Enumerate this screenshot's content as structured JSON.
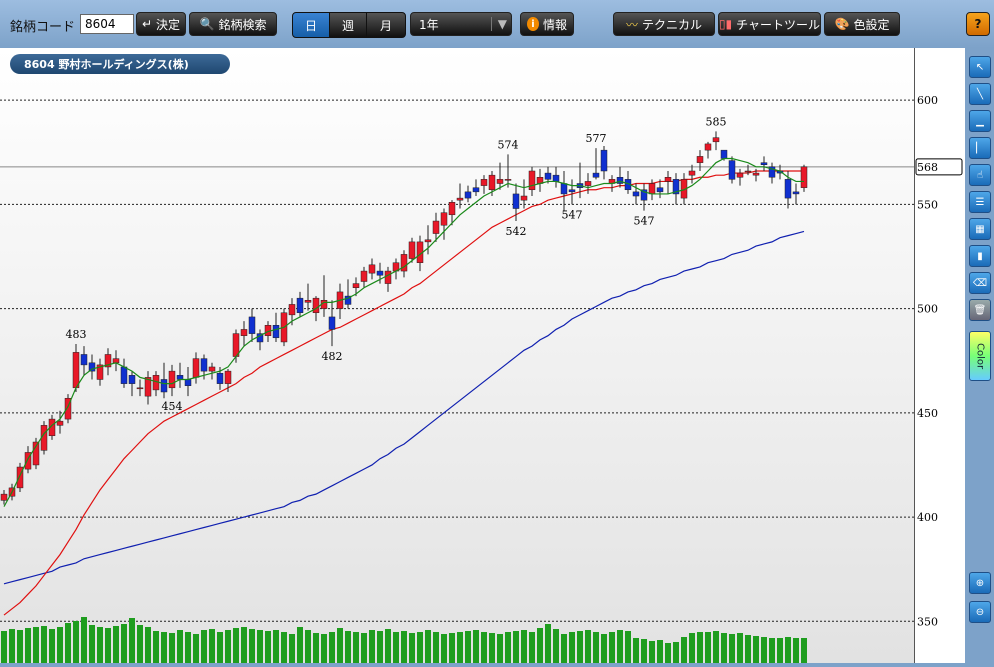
{
  "toolbar": {
    "code_label": "銘柄コード",
    "code_value": "8604",
    "decide_label": "決定",
    "search_label": "銘柄検索",
    "period_tabs": [
      "日",
      "週",
      "月"
    ],
    "range_value": "1年",
    "info_label": "情報",
    "technical_label": "テクニカル",
    "charttool_label": "チャートツール",
    "color_label": "色設定",
    "help_label": "?"
  },
  "chart": {
    "symbol": "8604 野村ホールディングス(株)",
    "current_price": "568",
    "price_labels": [
      "600",
      "550",
      "500",
      "450",
      "400",
      "350"
    ],
    "annotations": [
      "483",
      "454",
      "482",
      "574",
      "542",
      "577",
      "547",
      "547",
      "585"
    ]
  },
  "rightbar": {
    "color_label": "Color",
    "tools": [
      "pointer-icon",
      "trendline-icon",
      "horizontal-line-icon",
      "vertical-line-icon",
      "hand-icon",
      "fibonacci-icon",
      "count-icon",
      "span-icon",
      "eraser-icon",
      "trash-icon"
    ]
  },
  "chart_data": {
    "type": "candlestick",
    "ylim": [
      330,
      625
    ],
    "y_ticks": [
      600,
      550,
      500,
      450,
      400,
      350
    ],
    "current_price": 568,
    "candles": [
      [
        408,
        413,
        406,
        411
      ],
      [
        410,
        416,
        408,
        414
      ],
      [
        414,
        426,
        412,
        424
      ],
      [
        423,
        434,
        421,
        431
      ],
      [
        425,
        438,
        423,
        436
      ],
      [
        432,
        446,
        430,
        444
      ],
      [
        439,
        449,
        437,
        447
      ],
      [
        444,
        451,
        440,
        446
      ],
      [
        447,
        459,
        445,
        457
      ],
      [
        462,
        483,
        460,
        479
      ],
      [
        478,
        482,
        468,
        473
      ],
      [
        474,
        478,
        466,
        470
      ],
      [
        466,
        476,
        463,
        473
      ],
      [
        472,
        481,
        468,
        478
      ],
      [
        474,
        480,
        470,
        476
      ],
      [
        472,
        476,
        462,
        464
      ],
      [
        468,
        470,
        458,
        464
      ],
      [
        462,
        466,
        458,
        462
      ],
      [
        458,
        470,
        454,
        467
      ],
      [
        461,
        470,
        458,
        468
      ],
      [
        466,
        474,
        457,
        460
      ],
      [
        462,
        473,
        458,
        470
      ],
      [
        468,
        474,
        462,
        466
      ],
      [
        466,
        472,
        458,
        463
      ],
      [
        467,
        479,
        464,
        476
      ],
      [
        476,
        478,
        466,
        470
      ],
      [
        470,
        474,
        466,
        472
      ],
      [
        469,
        472,
        461,
        464
      ],
      [
        464,
        471,
        460,
        470
      ],
      [
        477,
        490,
        474,
        488
      ],
      [
        487,
        494,
        482,
        490
      ],
      [
        496,
        500,
        484,
        488
      ],
      [
        488,
        490,
        480,
        484
      ],
      [
        487,
        494,
        484,
        492
      ],
      [
        492,
        498,
        484,
        486
      ],
      [
        484,
        500,
        482,
        498
      ],
      [
        497,
        505,
        492,
        502
      ],
      [
        505,
        508,
        496,
        498
      ],
      [
        503,
        512,
        499,
        504
      ],
      [
        498,
        506,
        494,
        505
      ],
      [
        500,
        516,
        496,
        504
      ],
      [
        496,
        504,
        482,
        490
      ],
      [
        500,
        512,
        495,
        508
      ],
      [
        506,
        514,
        500,
        502
      ],
      [
        510,
        515,
        506,
        512
      ],
      [
        513,
        520,
        510,
        518
      ],
      [
        517,
        524,
        514,
        521
      ],
      [
        518,
        522,
        512,
        516
      ],
      [
        512,
        520,
        508,
        518
      ],
      [
        518,
        524,
        514,
        522
      ],
      [
        518,
        528,
        515,
        526
      ],
      [
        524,
        534,
        522,
        532
      ],
      [
        522,
        535,
        518,
        532
      ],
      [
        532,
        540,
        526,
        533
      ],
      [
        536,
        546,
        532,
        542
      ],
      [
        540,
        548,
        533,
        546
      ],
      [
        545,
        552,
        540,
        551
      ],
      [
        552,
        560,
        548,
        553
      ],
      [
        556,
        559,
        551,
        553
      ],
      [
        558,
        562,
        554,
        556
      ],
      [
        559,
        564,
        555,
        562
      ],
      [
        557,
        566,
        554,
        564
      ],
      [
        560,
        570,
        557,
        562
      ],
      [
        562,
        574,
        558,
        562
      ],
      [
        555,
        560,
        542,
        548
      ],
      [
        552,
        562,
        548,
        554
      ],
      [
        557,
        568,
        554,
        566
      ],
      [
        560,
        567,
        556,
        563
      ],
      [
        565,
        568,
        560,
        562
      ],
      [
        564,
        568,
        558,
        561
      ],
      [
        560,
        566,
        547,
        555
      ],
      [
        557,
        562,
        550,
        556
      ],
      [
        560,
        570,
        553,
        558
      ],
      [
        559,
        565,
        555,
        561
      ],
      [
        565,
        577,
        562,
        563
      ],
      [
        576,
        578,
        562,
        566
      ],
      [
        560,
        564,
        556,
        562
      ],
      [
        563,
        568,
        558,
        560
      ],
      [
        562,
        566,
        555,
        557
      ],
      [
        556,
        560,
        550,
        554
      ],
      [
        557,
        560,
        547,
        552
      ],
      [
        555,
        562,
        552,
        560
      ],
      [
        558,
        562,
        553,
        556
      ],
      [
        561,
        566,
        555,
        563
      ],
      [
        562,
        565,
        550,
        555
      ],
      [
        553,
        565,
        550,
        562
      ],
      [
        564,
        569,
        560,
        566
      ],
      [
        570,
        576,
        566,
        573
      ],
      [
        576,
        580,
        572,
        579
      ],
      [
        580,
        585,
        576,
        582
      ],
      [
        576,
        576,
        571,
        572
      ],
      [
        571,
        573,
        560,
        562
      ],
      [
        563,
        567,
        559,
        565
      ],
      [
        566,
        569,
        564,
        566
      ],
      [
        564,
        567,
        561,
        565
      ],
      [
        570,
        573,
        566,
        569
      ],
      [
        568,
        570,
        560,
        563
      ],
      [
        566,
        569,
        562,
        565
      ],
      [
        562,
        566,
        548,
        553
      ],
      [
        556,
        560,
        550,
        555
      ],
      [
        558,
        569,
        556,
        568
      ]
    ],
    "ma5": [
      405,
      412,
      420,
      428,
      434,
      440,
      444,
      447,
      453,
      462,
      468,
      471,
      472,
      473,
      474,
      472,
      470,
      467,
      466,
      465,
      464,
      464,
      466,
      466,
      467,
      468,
      469,
      470,
      472,
      477,
      482,
      485,
      487,
      489,
      490,
      491,
      494,
      496,
      498,
      500,
      503,
      503,
      504,
      505,
      507,
      510,
      512,
      514,
      516,
      518,
      520,
      523,
      526,
      529,
      533,
      537,
      541,
      545,
      548,
      551,
      554,
      556,
      558,
      560,
      559,
      558,
      559,
      560,
      561,
      561,
      560,
      559,
      559,
      558,
      559,
      560,
      560,
      561,
      560,
      558,
      556,
      555,
      555,
      555,
      556,
      557,
      559,
      562,
      566,
      570,
      572,
      572,
      571,
      570,
      568,
      568,
      567,
      566,
      563,
      561,
      561
    ],
    "ma25": [
      353,
      356,
      359,
      363,
      367,
      372,
      377,
      382,
      388,
      394,
      401,
      407,
      413,
      418,
      423,
      428,
      432,
      436,
      440,
      443,
      446,
      448,
      450,
      452,
      454,
      456,
      458,
      460,
      462,
      464,
      467,
      469,
      472,
      474,
      476,
      478,
      480,
      482,
      484,
      486,
      488,
      490,
      491,
      493,
      495,
      497,
      499,
      501,
      503,
      505,
      507,
      510,
      512,
      515,
      518,
      521,
      524,
      527,
      530,
      533,
      536,
      539,
      541,
      543,
      545,
      547,
      549,
      550,
      552,
      553,
      554,
      555,
      556,
      557,
      557,
      558,
      558,
      559,
      559,
      560,
      560,
      560,
      561,
      561,
      561,
      562,
      562,
      563,
      563,
      564,
      564,
      565,
      565,
      565,
      566,
      566,
      566,
      566,
      566,
      566,
      566
    ],
    "ma75": [
      368,
      369,
      370,
      371,
      372,
      373,
      374,
      376,
      377,
      378,
      380,
      381,
      382,
      383,
      384,
      385,
      386,
      387,
      388,
      389,
      390,
      391,
      392,
      393,
      394,
      395,
      396,
      397,
      398,
      399,
      400,
      401,
      402,
      403,
      404,
      405,
      407,
      408,
      410,
      411,
      413,
      415,
      417,
      419,
      421,
      423,
      425,
      428,
      430,
      433,
      435,
      438,
      441,
      444,
      447,
      450,
      453,
      456,
      459,
      462,
      465,
      468,
      471,
      474,
      477,
      480,
      482,
      485,
      487,
      490,
      492,
      495,
      497,
      499,
      501,
      503,
      505,
      506,
      508,
      509,
      511,
      512,
      514,
      515,
      516,
      518,
      519,
      520,
      522,
      523,
      524,
      526,
      527,
      528,
      530,
      531,
      532,
      534,
      535,
      536,
      537
    ],
    "volume": [
      32,
      34,
      33,
      35,
      36,
      37,
      34,
      36,
      40,
      42,
      46,
      38,
      36,
      35,
      37,
      39,
      45,
      38,
      36,
      32,
      31,
      30,
      33,
      31,
      29,
      33,
      34,
      31,
      33,
      35,
      36,
      34,
      33,
      32,
      33,
      31,
      29,
      36,
      33,
      30,
      29,
      31,
      35,
      32,
      31,
      30,
      33,
      32,
      34,
      31,
      32,
      30,
      31,
      33,
      31,
      29,
      30,
      31,
      32,
      33,
      31,
      30,
      29,
      31,
      32,
      33,
      31,
      35,
      39,
      34,
      29,
      31,
      32,
      33,
      31,
      29,
      31,
      33,
      32,
      25,
      24,
      22,
      23,
      20,
      21,
      26,
      30,
      31,
      31,
      32,
      30,
      29,
      30,
      28,
      27,
      26,
      25,
      25,
      26,
      25,
      25
    ]
  }
}
